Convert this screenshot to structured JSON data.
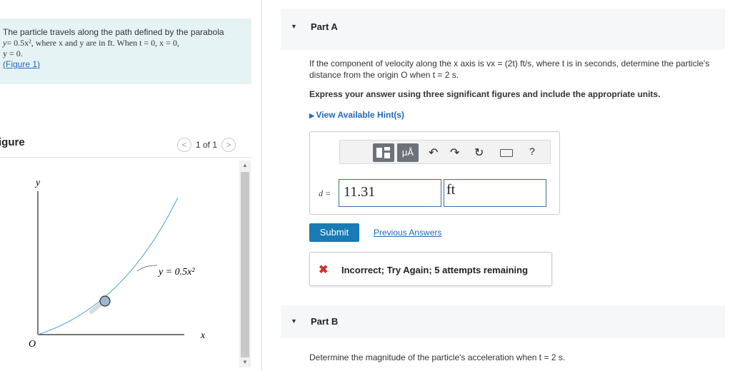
{
  "problem": {
    "line1": "The particle travels along the path defined by the parabola",
    "eq1_lhs": "y",
    "eq1_rhs": "= 0.5x², where x and y are in ft. When t = 0, x = 0,",
    "eq2": "y = 0.",
    "figure_link": "(Figure 1)"
  },
  "figure": {
    "title": "igure",
    "pager_text": "1 of 1",
    "prev_glyph": "<",
    "next_glyph": ">",
    "axis_y": "y",
    "axis_x": "x",
    "origin": "O",
    "curve_label": "y = 0.5x²"
  },
  "partA": {
    "label": "Part A",
    "question": "If the component of velocity along the x axis is vx = (2t) ft/s, where t is in seconds, determine the particle's distance from the origin O when t = 2 s.",
    "instruction": "Express your answer using three significant figures and include the appropriate units.",
    "hints": "View Available Hint(s)",
    "variable_label": "d =",
    "answer_value": "11.31",
    "unit_value": "ft",
    "toolbar": {
      "mu_label": "μÅ",
      "help": "?"
    },
    "submit": "Submit",
    "previous_answers": "Previous Answers",
    "feedback": "Incorrect; Try Again; 5 attempts remaining"
  },
  "partB": {
    "label": "Part B",
    "question": "Determine the magnitude of the particle's acceleration when t = 2 s."
  },
  "colors": {
    "accent": "#1a7ab3",
    "link": "#2468b3",
    "problem_bg": "#e6f3f5",
    "error": "#d0312d",
    "curve": "#4aa3d8"
  }
}
